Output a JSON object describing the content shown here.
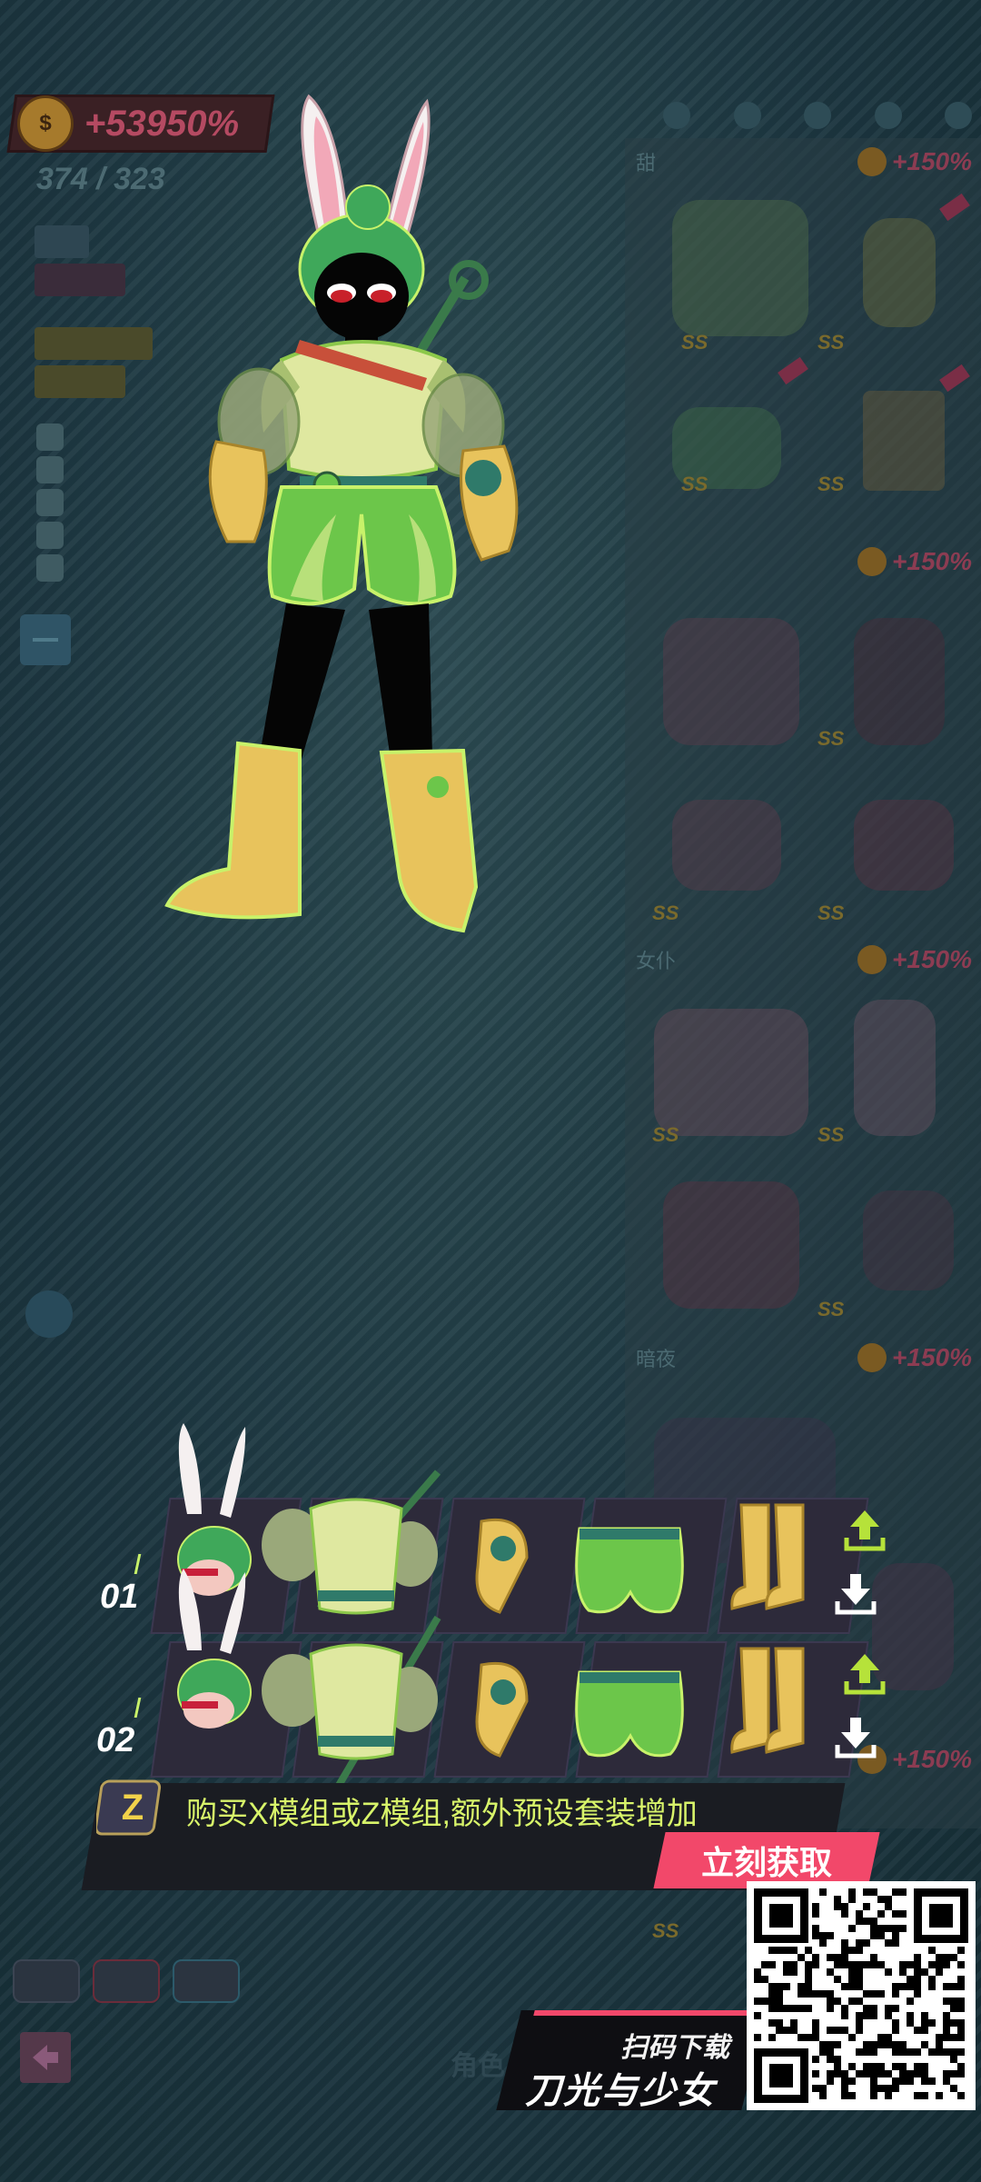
{
  "hud": {
    "coin_bonus": "+53950%",
    "coin_symbol": "$",
    "counter": "374 / 323"
  },
  "panel": {
    "sections": [
      {
        "title": "甜",
        "bonus": "+150%"
      },
      {
        "title": "",
        "bonus": "+150%"
      },
      {
        "title": "女仆",
        "bonus": "+150%"
      },
      {
        "title": "暗夜",
        "bonus": "+150%"
      },
      {
        "title": "",
        "bonus": "+150%"
      }
    ],
    "ss_label": "SS"
  },
  "outfits": {
    "rows": [
      {
        "label": "01",
        "items": [
          "head",
          "top",
          "gloves",
          "shorts",
          "boots"
        ]
      },
      {
        "label": "02",
        "items": [
          "head",
          "top",
          "gloves",
          "shorts",
          "boots"
        ]
      }
    ],
    "icons": [
      "upload-icon",
      "download-icon"
    ]
  },
  "promo": {
    "badge": "Z",
    "text": "购买X模组或Z模组,额外预设套装增加",
    "button": "立刻获取"
  },
  "bottom": {
    "nav_ghost": "角色",
    "brand_scan": "扫码下载",
    "brand_name": "刀光与少女"
  },
  "colors": {
    "accent_pink": "#f2486a",
    "accent_lime": "#c8f26a",
    "promo_text": "#d8f46a",
    "hair_green": "#3fa85a",
    "outfit_green": "#6cc64a",
    "boot_yellow": "#e8c35c"
  }
}
